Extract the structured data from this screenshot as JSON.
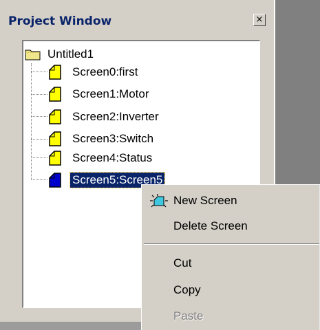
{
  "window": {
    "title": "Project Window",
    "close_glyph": "×"
  },
  "tree": {
    "root": {
      "label": "Untitled1",
      "icon": "folder-icon"
    },
    "items": [
      {
        "label": "Screen0:first",
        "icon": "screen-icon",
        "selected": false
      },
      {
        "label": "Screen1:Motor",
        "icon": "screen-icon",
        "selected": false
      },
      {
        "label": "Screen2:Inverter",
        "icon": "screen-icon",
        "selected": false
      },
      {
        "label": "Screen3:Switch",
        "icon": "screen-icon",
        "selected": false
      },
      {
        "label": "Screen4:Status",
        "icon": "screen-icon",
        "selected": false
      },
      {
        "label": "Screen5:Screen5",
        "icon": "screen-icon-selected",
        "selected": true
      }
    ]
  },
  "context_menu": {
    "new_screen": "New Screen",
    "delete_screen": "Delete Screen",
    "cut": "Cut",
    "copy": "Copy",
    "paste": "Paste",
    "new_screen_icon": "new-screen-icon"
  },
  "colors": {
    "face": "#d4d0c8",
    "title_text": "#0a246a",
    "selection": "#0a246a",
    "folder": "#f0e68c",
    "screen_icon": "#ffff00",
    "screen_icon_selected": "#0000cc"
  }
}
